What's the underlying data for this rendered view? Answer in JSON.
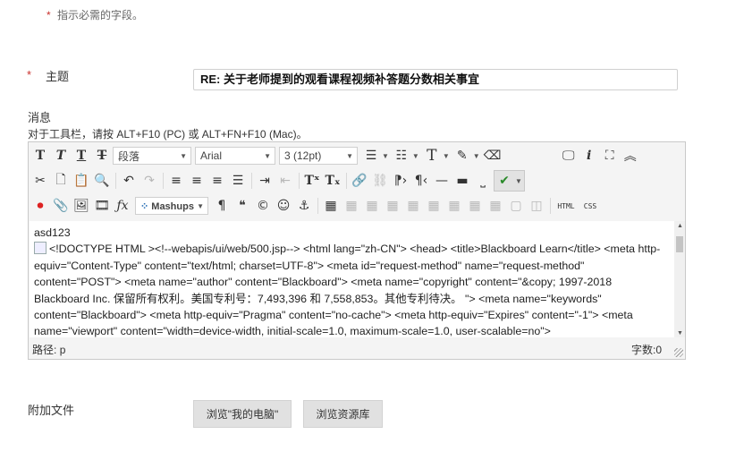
{
  "required_note": {
    "star": "*",
    "text": "指示必需的字段。"
  },
  "subject": {
    "star": "*",
    "label": "主题",
    "value": "RE: 关于老师提到的观看课程视频补答题分数相关事宜"
  },
  "message": {
    "label": "消息",
    "toolbar_hint": "对于工具栏，请按 ALT+F10 (PC) 或 ALT+FN+F10 (Mac)。"
  },
  "editor": {
    "format_select": "段落",
    "font_select": "Arial",
    "size_select": "3 (12pt)",
    "mashups_label": "Mashups",
    "html_label": "HTML",
    "css_label": "CSS",
    "content_first_line": "asd123",
    "content_body": "<!DOCTYPE HTML ><!--webapis/ui/web/500.jsp--> <html lang=\"zh-CN\"> <head> <title>Blackboard Learn</title> <meta http-equiv=\"Content-Type\" content=\"text/html; charset=UTF-8\"> <meta id=\"request-method\" name=\"request-method\" content=\"POST\"> <meta name=\"author\" content=\"Blackboard\"> <meta name=\"copyright\" content=\"&copy; 1997-2018 Blackboard Inc. 保留所有权利。美国专利号：7,493,396 和 7,558,853。其他专利待决。 \"> <meta name=\"keywords\" content=\"Blackboard\"> <meta http-equiv=\"Pragma\" content=\"no-cache\"> <meta http-equiv=\"Expires\" content=\"-1\"> <meta name=\"viewport\" content=\"width=device-width, initial-scale=1.0, maximum-scale=1.0, user-scalable=no\">",
    "path_label": "路径:",
    "path_value": "p",
    "word_count_label": "字数:",
    "word_count": "0"
  },
  "attachments": {
    "label": "附加文件",
    "browse_computer": "浏览\"我的电脑\"",
    "browse_repository": "浏览资源库"
  },
  "colors": {
    "required_star": "#c9302c",
    "button_bg": "#e1e1e1",
    "toolbar_bg": "#f4f4f4"
  }
}
